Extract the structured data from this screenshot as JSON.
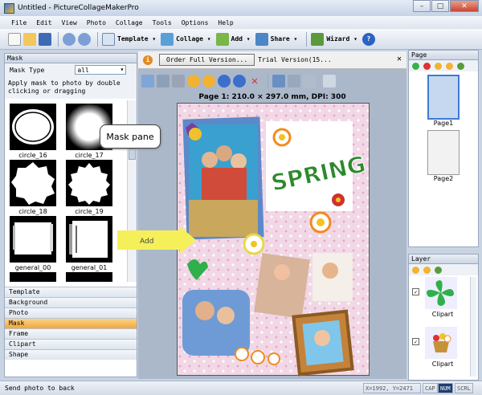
{
  "window": {
    "title": "Untitled - PictureCollageMakerPro"
  },
  "menu": [
    "File",
    "Edit",
    "View",
    "Photo",
    "Collage",
    "Tools",
    "Options",
    "Help"
  ],
  "toolbar": {
    "template": "Template",
    "collage": "Collage",
    "add": "Add",
    "share": "Share",
    "wizard": "Wizard"
  },
  "mask_panel": {
    "title": "Mask",
    "type_label": "Mask Type",
    "type_value": "all",
    "instructions": "Apply mask to photo by double clicking or dragging",
    "thumbs": [
      "circle_16",
      "circle_17",
      "circle_18",
      "circle_19",
      "general_00",
      "general_01"
    ]
  },
  "categories": [
    "Template",
    "Background",
    "Photo",
    "Mask",
    "Frame",
    "Clipart",
    "Shape"
  ],
  "order": {
    "button": "Order Full Version...",
    "trial": "Trial Version(15..."
  },
  "page_info": "Page 1: 210.0 × 297.0 mm, DPI: 300",
  "canvas": {
    "spring_text": "SPRING"
  },
  "page_panel": {
    "title": "Page",
    "pages": [
      "Page1",
      "Page2"
    ]
  },
  "layer_panel": {
    "title": "Layer",
    "layers": [
      "Clipart",
      "Clipart"
    ]
  },
  "status": {
    "text": "Send photo to back",
    "coords": "X=1992, Y=2471",
    "caps": "CAP",
    "num": "NUM",
    "scrl": "SCRL"
  },
  "callout": "Mask pane",
  "add_arrow": "Add"
}
